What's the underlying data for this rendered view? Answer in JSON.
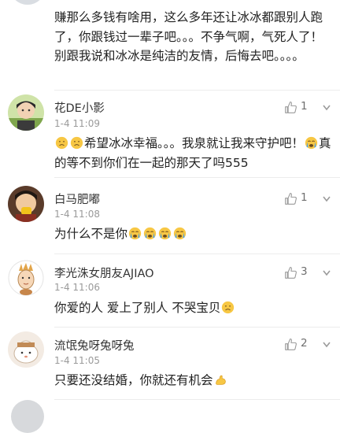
{
  "top_comment": {
    "text": "赚那么多钱有啥用，这么多年还让冰冰都跟别人跑了，你跟钱过一辈子吧。。。不争气啊，气死人了！别跟我说和冰冰是纯洁的友情，后悔去吧。。。。"
  },
  "comments": [
    {
      "username": "花DE小影",
      "time": "1-4 11:09",
      "likes": "1",
      "text_before": "希望冰冰幸福。。。我泉就让我来守护吧！",
      "text_after": "真的等不到你们在一起的那天了吗555"
    },
    {
      "username": "白马肥嘟",
      "time": "1-4 11:08",
      "likes": "1",
      "text": "为什么不是你"
    },
    {
      "username": "李光洙女朋友AJIAO",
      "time": "1-4 11:06",
      "likes": "3",
      "text": "你爱的人 爱上了别人 不哭宝贝"
    },
    {
      "username": "流氓兔呀兔呀兔",
      "time": "1-4 11:05",
      "likes": "2",
      "text": "只要还没结婚，你就还有机会"
    }
  ],
  "icons": {
    "like": "thumbs-up-icon",
    "more": "chevron-down-icon",
    "sad_emoji": "sad-face-emoji",
    "crying_emoji": "crying-face-emoji",
    "strong_emoji": "flexed-arm-emoji"
  },
  "colors": {
    "text": "#222222",
    "meta": "#9a9a9a",
    "like_count": "#6f6f6f",
    "divider": "#ececec",
    "emoji_yellow": "#f7c744"
  }
}
